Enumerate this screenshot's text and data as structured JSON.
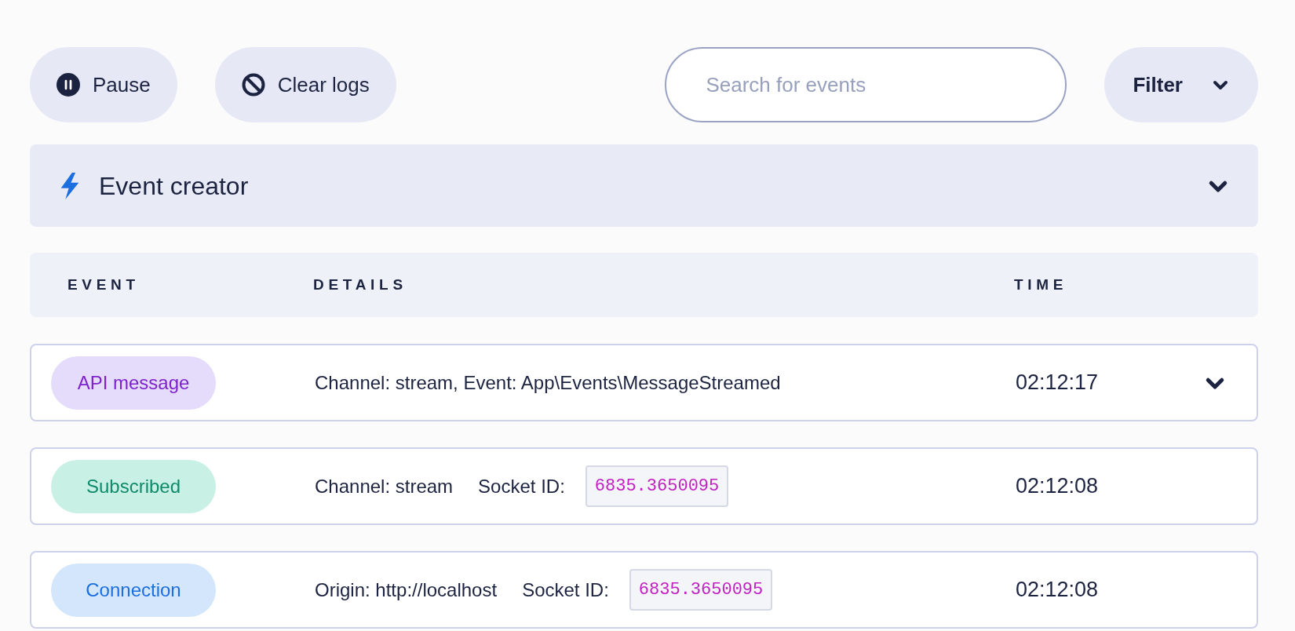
{
  "toolbar": {
    "pause": "Pause",
    "clear": "Clear logs",
    "search": {
      "placeholder": "Search for events"
    },
    "filter": "Filter"
  },
  "event_creator": {
    "title": "Event creator",
    "expanded": false
  },
  "table": {
    "columns": [
      "EVENT",
      "DETAILS",
      "TIME"
    ],
    "rows": [
      {
        "event": "API message",
        "color": "#7e22ce",
        "details": [
          {
            "kind": "text",
            "text": "Channel: stream, Event: App\\Events\\MessageStreamed"
          }
        ],
        "time": "02:12:17",
        "expandable": true
      },
      {
        "event": "Subscribed",
        "color": "#0f8a6a",
        "details": [
          {
            "kind": "text",
            "text": "Channel: stream"
          },
          {
            "kind": "text",
            "text": "Socket ID:"
          },
          {
            "kind": "code",
            "text": "6835.3650095"
          }
        ],
        "time": "02:12:08",
        "expandable": false
      },
      {
        "event": "Connection",
        "color": "#1d6fe0",
        "details": [
          {
            "kind": "text",
            "text": "Origin: http://localhost"
          },
          {
            "kind": "text",
            "text": "Socket ID:"
          },
          {
            "kind": "code",
            "text": "6835.3650095"
          }
        ],
        "time": "02:12:08",
        "expandable": false
      }
    ]
  }
}
